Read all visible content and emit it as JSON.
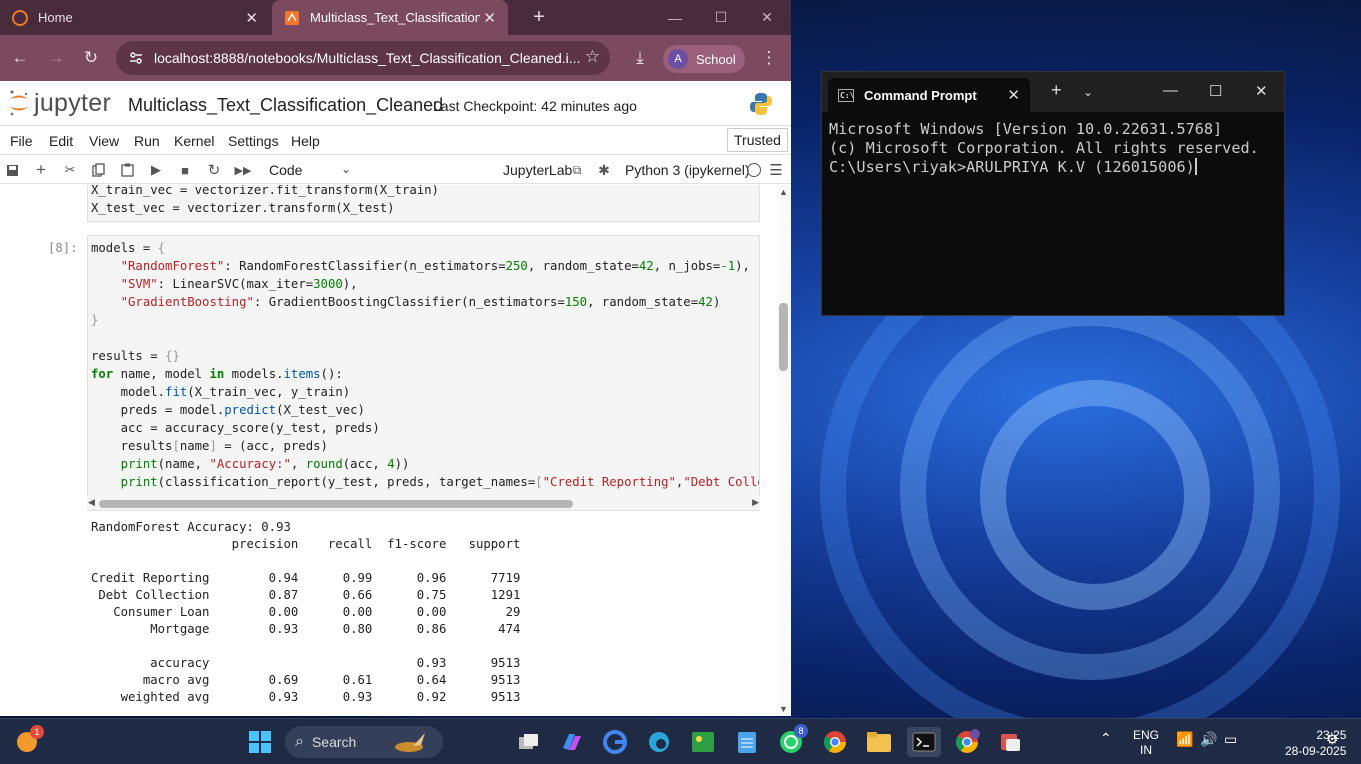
{
  "browser": {
    "tabs": [
      {
        "label": "Home"
      },
      {
        "label": "Multiclass_Text_Classification_Cl"
      }
    ],
    "url": "localhost:8888/notebooks/Multiclass_Text_Classification_Cleaned.i...",
    "profile_initial": "A",
    "profile_label": "School"
  },
  "jupyter": {
    "logo_text": "jupyter",
    "notebook_title": "Multiclass_Text_Classification_Cleaned",
    "checkpoint": "Last Checkpoint: 42 minutes ago",
    "menu": [
      "File",
      "Edit",
      "View",
      "Run",
      "Kernel",
      "Settings",
      "Help"
    ],
    "trusted": "Trusted",
    "cell_type": "Code",
    "jupyterlab_label": "JupyterLab",
    "kernel_label": "Python 3 (ipykernel)"
  },
  "cells": {
    "prev_code": [
      "X_train_vec = vectorizer.fit_transform(X_train)",
      "X_test_vec = vectorizer.transform(X_test)"
    ],
    "prompt": "[8]:",
    "output": {
      "header_line": "RandomForest Accuracy: 0.93",
      "columns": [
        "precision",
        "recall",
        "f1-score",
        "support"
      ],
      "rows": [
        {
          "label": "Credit Reporting",
          "precision": "0.94",
          "recall": "0.99",
          "f1": "0.96",
          "support": "7719"
        },
        {
          "label": "Debt Collection",
          "precision": "0.87",
          "recall": "0.66",
          "f1": "0.75",
          "support": "1291"
        },
        {
          "label": "Consumer Loan",
          "precision": "0.00",
          "recall": "0.00",
          "f1": "0.00",
          "support": "29"
        },
        {
          "label": "Mortgage",
          "precision": "0.93",
          "recall": "0.80",
          "f1": "0.86",
          "support": "474"
        }
      ],
      "summary": [
        {
          "label": "accuracy",
          "precision": "",
          "recall": "",
          "f1": "0.93",
          "support": "9513"
        },
        {
          "label": "macro avg",
          "precision": "0.69",
          "recall": "0.61",
          "f1": "0.64",
          "support": "9513"
        },
        {
          "label": "weighted avg",
          "precision": "0.93",
          "recall": "0.93",
          "f1": "0.92",
          "support": "9513"
        }
      ]
    }
  },
  "cmd": {
    "title": "Command Prompt",
    "lines": [
      "Microsoft Windows [Version 10.0.22631.5768]",
      "(c) Microsoft Corporation. All rights reserved.",
      "",
      "C:\\Users\\riyak>ARULPRIYA K.V (126015006)"
    ]
  },
  "taskbar": {
    "search_placeholder": "Search",
    "weather_badge": "1",
    "whatsapp_badge": "8",
    "lang_line1": "ENG",
    "lang_line2": "IN",
    "time": "23:25",
    "date": "28-09-2025"
  },
  "colors": {
    "browser_frame": "#482c3c",
    "browser_toolbar": "#7b4a5e",
    "jupyter_orange": "#f37726",
    "code_keyword": "#008000",
    "code_string": "#ba2121"
  }
}
